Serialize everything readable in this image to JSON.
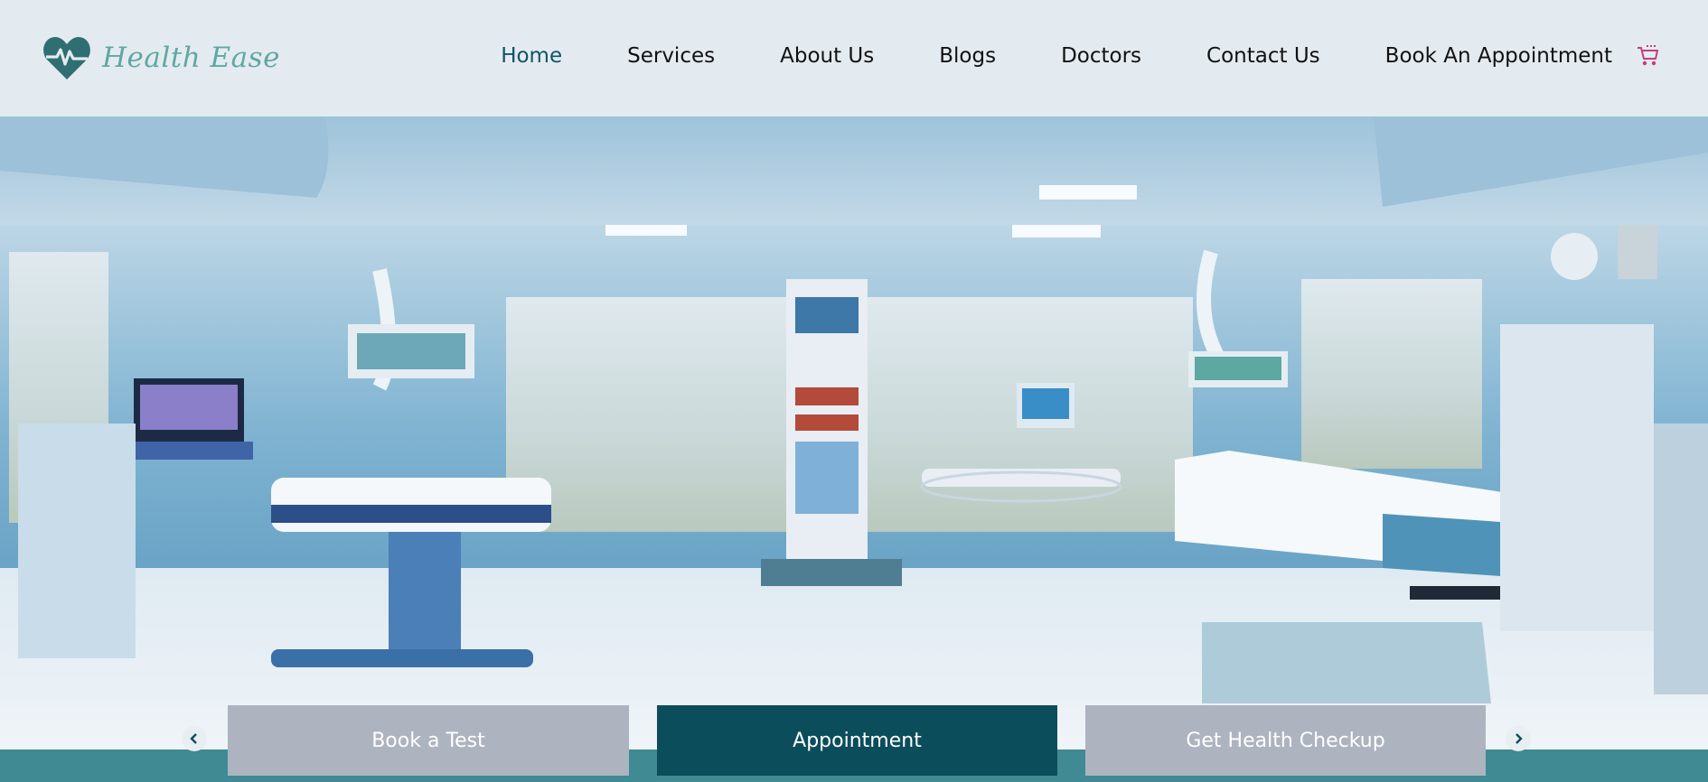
{
  "brand": {
    "name": "Health Ease",
    "logo_icon": "heart-pulse-icon",
    "color": "#5fa8a3"
  },
  "nav": {
    "items": [
      {
        "label": "Home",
        "active": true
      },
      {
        "label": "Services",
        "active": false
      },
      {
        "label": "About Us",
        "active": false
      },
      {
        "label": "Blogs",
        "active": false
      },
      {
        "label": "Doctors",
        "active": false
      },
      {
        "label": "Contact Us",
        "active": false
      },
      {
        "label": "Book An Appointment",
        "active": false
      }
    ],
    "cart_icon": "cart-icon"
  },
  "hero": {
    "image": "hospital-room-photo",
    "actions": [
      {
        "label": "Book a Test",
        "style": "grey"
      },
      {
        "label": "Appointment",
        "style": "dark"
      },
      {
        "label": "Get Health Checkup",
        "style": "grey"
      }
    ],
    "prev_icon": "chevron-left-icon",
    "next_icon": "chevron-right-icon"
  },
  "colors": {
    "accent": "#0c4d5c",
    "strip": "#3f8a93",
    "header_bg": "#e4ebf0",
    "button_grey": "#aeb3c0"
  }
}
